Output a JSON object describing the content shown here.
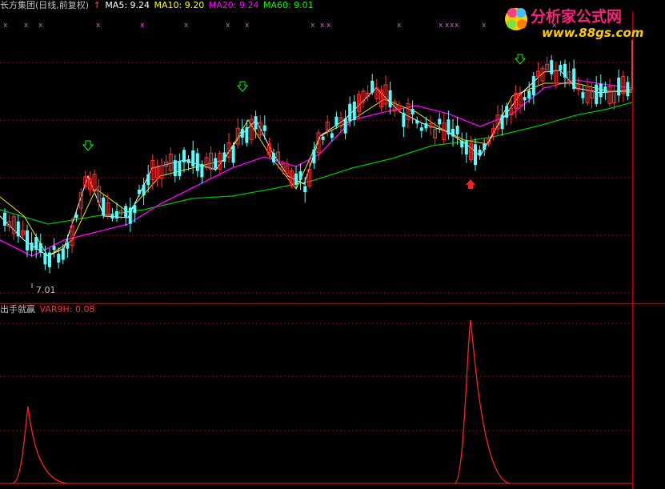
{
  "header": {
    "title": "长方集团(日线,前复权)",
    "ma": [
      {
        "label": "MA5: 9.24",
        "color": "#ffffff"
      },
      {
        "label": "MA10: 9.20",
        "color": "#ffff00"
      },
      {
        "label": "MA20: 9.24",
        "color": "#ff00ff"
      },
      {
        "label": "MA60: 9.01",
        "color": "#00ff00"
      }
    ]
  },
  "price_panel": {
    "low_label": "7.01",
    "colors": {
      "up": "#ff3030",
      "down": "#54ffff",
      "grid": "#a00000",
      "ma5": "#ffffff",
      "ma10": "#e8e800",
      "ma20": "#ff00ff",
      "ma60": "#00c000"
    }
  },
  "indicator_panel": {
    "name": "出手就赢",
    "var_label": "VAR9H: 0.08",
    "var_color": "#ff3030"
  },
  "watermark": {
    "text": "分析家公式网",
    "url": "www.88gs.com"
  }
}
